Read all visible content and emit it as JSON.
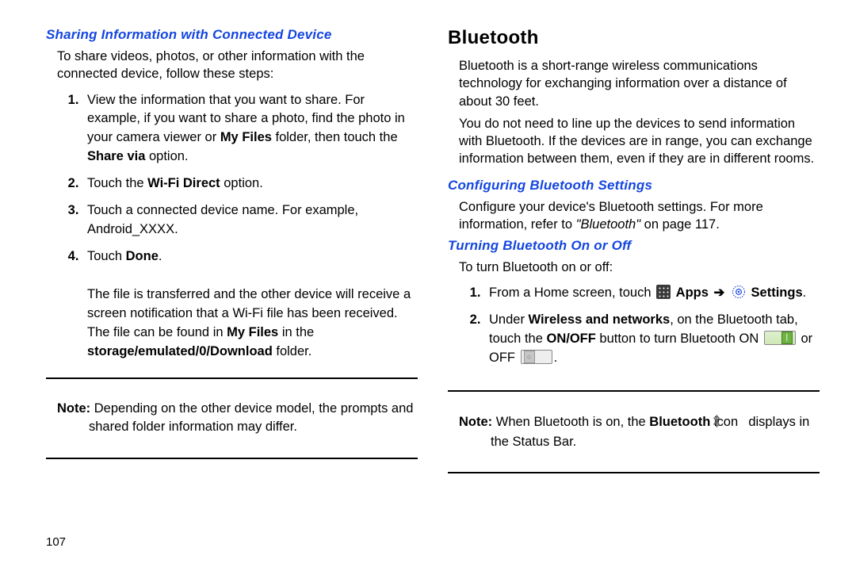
{
  "pageNumber": "107",
  "left": {
    "heading": "Sharing Information with Connected Device",
    "intro": "To share videos, photos, or other information with the connected device, follow these steps:",
    "steps": {
      "s1a": "View the information that you want to share. For example, if you want to share a photo, find the photo in your camera viewer or ",
      "s1b": "My Files",
      "s1c": " folder, then touch the ",
      "s1d": "Share via",
      "s1e": " option.",
      "s2a": "Touch the ",
      "s2b": "Wi-Fi Direct",
      "s2c": " option.",
      "s3": "Touch a connected device name. For example, Android_XXXX.",
      "s4a": "Touch ",
      "s4b": "Done",
      "s4c": ".",
      "afterA": "The file is transferred and the other device will receive a screen notification that a Wi-Fi file has been received. The file can be found in ",
      "afterB": "My Files",
      "afterC": " in the ",
      "afterD": "storage/emulated/0/Download",
      "afterE": " folder."
    },
    "noteLabel": "Note:",
    "noteText": " Depending on the other device model, the prompts and shared folder information may differ."
  },
  "right": {
    "title": "Bluetooth",
    "p1": "Bluetooth is a short-range wireless communications technology for exchanging information over a distance of about 30 feet.",
    "p2": "You do not need to line up the devices to send information with Bluetooth. If the devices are in range, you can exchange information between them, even if they are in different rooms.",
    "h1": "Configuring Bluetooth Settings",
    "confA": "Configure your device's Bluetooth settings. For more information, refer to ",
    "confB": "\"Bluetooth\"",
    "confC": " on page 117.",
    "h2": "Turning Bluetooth On or Off",
    "turnIntro": "To turn Bluetooth on or off:",
    "steps": {
      "s1a": "From a Home screen, touch ",
      "s1Apps": "Apps",
      "s1Arrow": "➔",
      "s1Settings": "Settings",
      "s1End": ".",
      "s2a": "Under ",
      "s2b": "Wireless and networks",
      "s2c": ", on the Bluetooth tab, touch the ",
      "s2d": "ON/OFF",
      "s2e": " button to turn Bluetooth ON ",
      "s2f": " or OFF ",
      "s2g": "."
    },
    "noteLabel": "Note:",
    "noteA": " When Bluetooth is on, the ",
    "noteB": "Bluetooth",
    "noteC": " icon ",
    "noteD": " displays in the Status Bar."
  }
}
